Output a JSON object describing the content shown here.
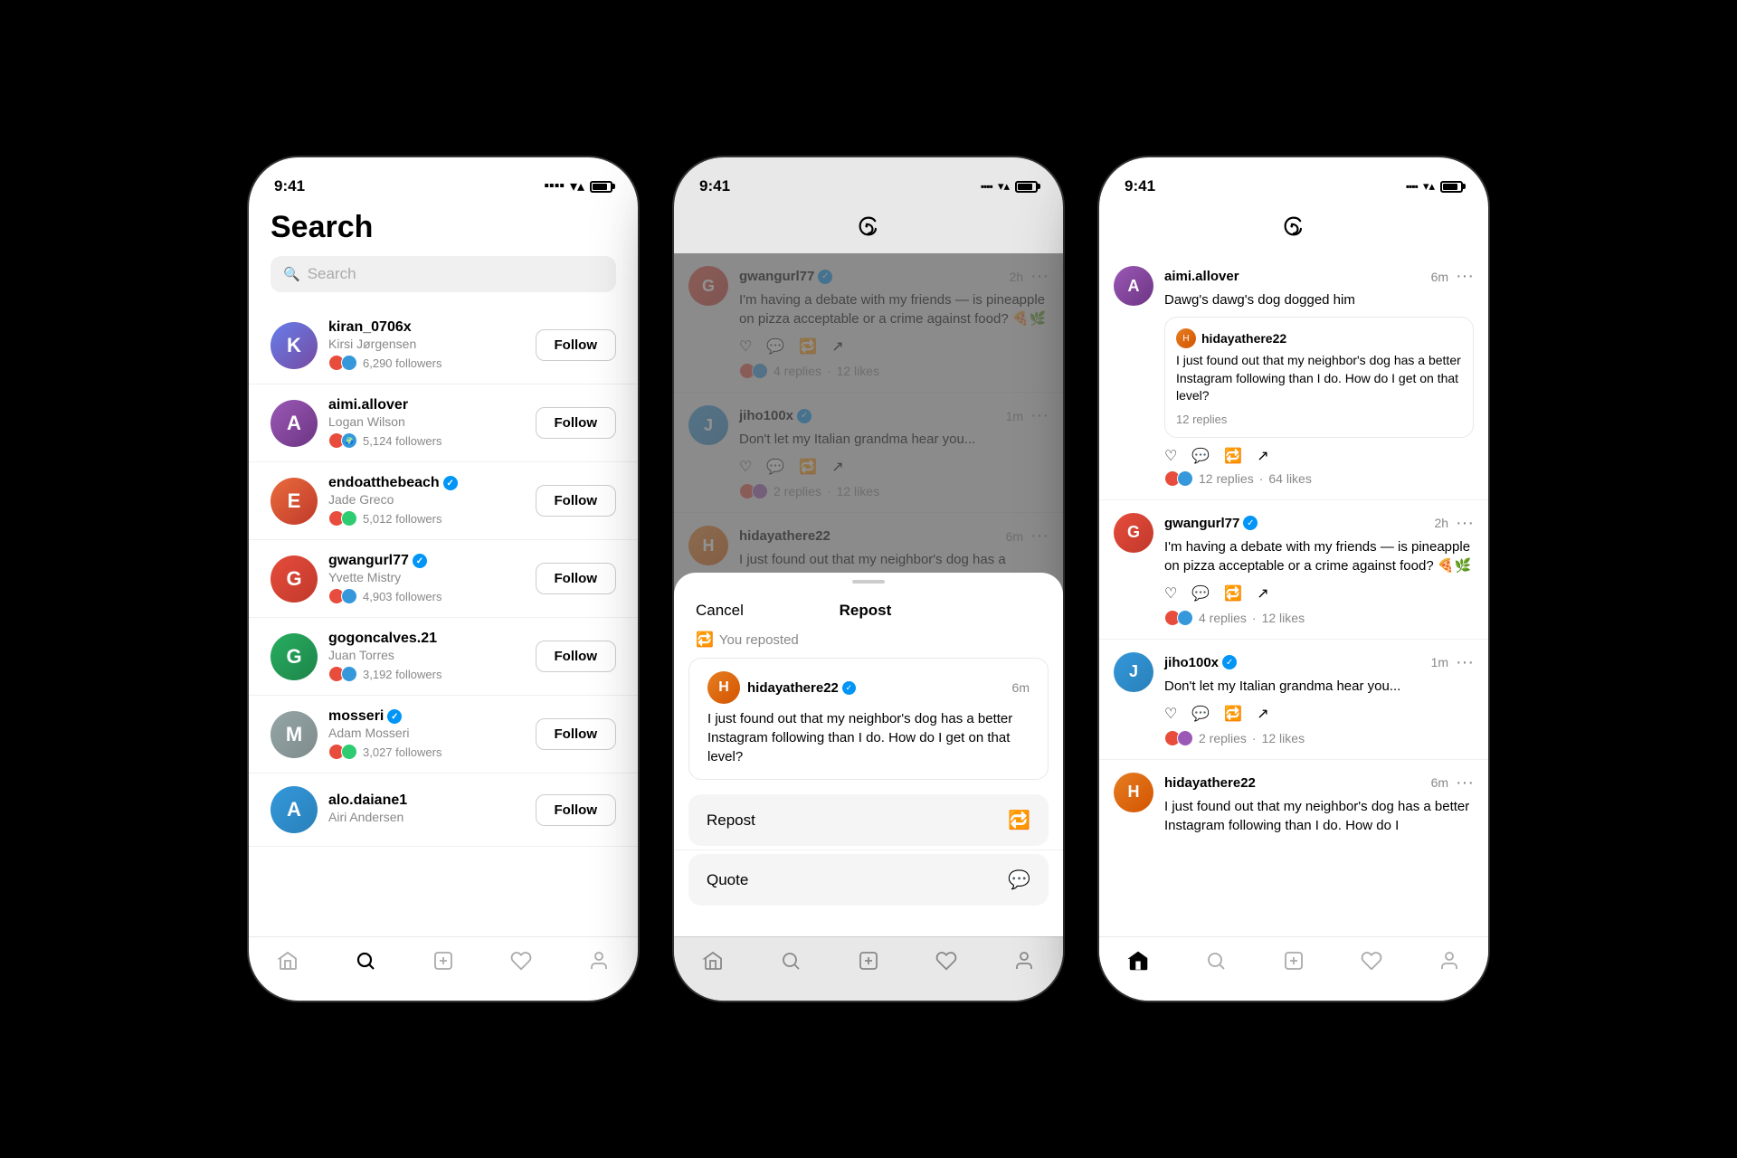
{
  "phones": {
    "left": {
      "time": "9:41",
      "screen": "search",
      "title": "Search",
      "search_placeholder": "Search",
      "users": [
        {
          "id": "kiran_0706x",
          "username": "kiran_0706x",
          "real_name": "Kirsi Jørgensen",
          "followers": "6,290 followers",
          "verified": false,
          "color1": "#667eea",
          "color2": "#764ba2",
          "initial": "K"
        },
        {
          "id": "aimi_allover",
          "username": "aimi.allover",
          "real_name": "Logan Wilson",
          "followers": "5,124 followers",
          "verified": false,
          "color1": "#9b59b6",
          "color2": "#8e44ad",
          "initial": "A"
        },
        {
          "id": "endoatthebeach",
          "username": "endoatthebeach",
          "real_name": "Jade Greco",
          "followers": "5,012 followers",
          "verified": true,
          "color1": "#e96c3c",
          "color2": "#c0392b",
          "initial": "E"
        },
        {
          "id": "gwangurl77",
          "username": "gwangurl77",
          "real_name": "Yvette Mistry",
          "followers": "4,903 followers",
          "verified": true,
          "color1": "#e74c3c",
          "color2": "#c0392b",
          "initial": "G"
        },
        {
          "id": "gogoncalves21",
          "username": "gogoncalves.21",
          "real_name": "Juan Torres",
          "followers": "3,192 followers",
          "verified": false,
          "color1": "#27ae60",
          "color2": "#1e8449",
          "initial": "G"
        },
        {
          "id": "mosseri",
          "username": "mosseri",
          "real_name": "Adam Mosseri",
          "followers": "3,027 followers",
          "verified": true,
          "color1": "#95a5a6",
          "color2": "#7f8c8d",
          "initial": "M"
        },
        {
          "id": "alo_daiane1",
          "username": "alo.daiane1",
          "real_name": "Airi Andersen",
          "followers": "",
          "verified": false,
          "color1": "#3498db",
          "color2": "#2980b9",
          "initial": "A"
        }
      ],
      "follow_label": "Follow",
      "nav": {
        "home": "🏠",
        "search": "🔍",
        "compose": "✏",
        "heart": "♡",
        "person": "👤"
      }
    },
    "mid": {
      "time": "9:41",
      "screen": "feed_modal",
      "posts": [
        {
          "username": "gwangurl77",
          "verified": true,
          "time": "2h",
          "text": "I'm having a debate with my friends — is pineapple on pizza acceptable or a crime against food? 🍕🌿",
          "replies": "4 replies",
          "likes": "12 likes",
          "color1": "#e74c3c",
          "initial": "G"
        },
        {
          "username": "jiho100x",
          "verified": true,
          "time": "1m",
          "text": "Don't let my Italian grandma hear you...",
          "replies": "2 replies",
          "likes": "12 likes",
          "color1": "#3498db",
          "initial": "J"
        },
        {
          "username": "hidayathere22",
          "verified": false,
          "time": "6m",
          "text": "I just found out that my neighbor's dog has a",
          "replies": "",
          "likes": "",
          "color1": "#e67e22",
          "initial": "H"
        }
      ],
      "modal": {
        "cancel_label": "Cancel",
        "title_label": "Repost",
        "reposted_label": "You reposted",
        "preview_username": "hidayathere22",
        "preview_verified": true,
        "preview_time": "6m",
        "preview_text": "I just found out that my neighbor's dog has a better Instagram following than I do. How do I get on that level?",
        "repost_btn": "Repost",
        "quote_btn": "Quote"
      }
    },
    "right": {
      "time": "9:41",
      "screen": "feed",
      "posts": [
        {
          "username": "aimi.allover",
          "verified": false,
          "time": "6m",
          "text": "Dawg's dawg's dog dogged him",
          "quoted": true,
          "quoted_username": "hidayathere22",
          "quoted_text": "I just found out that my neighbor's dog has a better Instagram following than I do. How do I get on that level?",
          "quoted_replies": "12 replies",
          "replies": "12 replies",
          "likes": "64 likes",
          "color1": "#9b59b6",
          "initial": "A"
        },
        {
          "username": "gwangurl77",
          "verified": true,
          "time": "2h",
          "text": "I'm having a debate with my friends — is pineapple on pizza acceptable or a crime against food? 🍕🌿",
          "replies": "4 replies",
          "likes": "12 likes",
          "color1": "#e74c3c",
          "initial": "G"
        },
        {
          "username": "jiho100x",
          "verified": true,
          "time": "1m",
          "text": "Don't let my Italian grandma hear you...",
          "replies": "2 replies",
          "likes": "12 likes",
          "color1": "#3498db",
          "initial": "J"
        },
        {
          "username": "hidayathere22",
          "verified": false,
          "time": "6m",
          "text": "I just found out that my neighbor's dog has a better Instagram following than I do. How do I",
          "replies": "",
          "likes": "",
          "color1": "#e67e22",
          "initial": "H"
        }
      ],
      "nav": {
        "home": "⌂",
        "search": "⌕",
        "compose": "⊕",
        "heart": "♡",
        "person": "○"
      }
    }
  }
}
